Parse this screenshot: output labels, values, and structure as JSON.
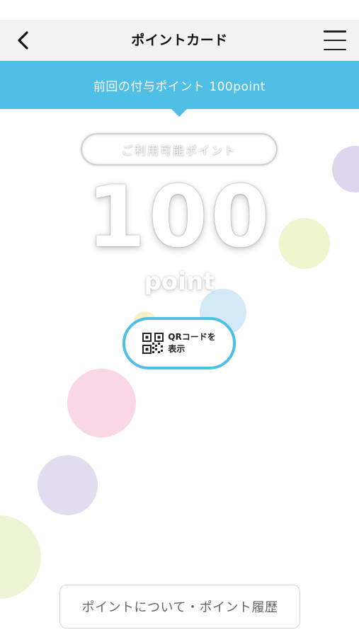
{
  "header": {
    "title": "ポイントカード",
    "back_icon": "chevron-left-icon",
    "menu_icon": "hamburger-menu-icon"
  },
  "banner": {
    "text": "前回の付与ポイント 100point"
  },
  "points": {
    "label": "ご利用可能ポイント",
    "value": "100",
    "unit": "point"
  },
  "qr_button": {
    "icon": "qr-code-icon",
    "line1": "QRコードを",
    "line2": "表示"
  },
  "footer": {
    "link_label": "ポイントについて・ポイント履歴"
  },
  "colors": {
    "accent": "#4fbfe6",
    "header_bg": "#f2f2f2"
  }
}
